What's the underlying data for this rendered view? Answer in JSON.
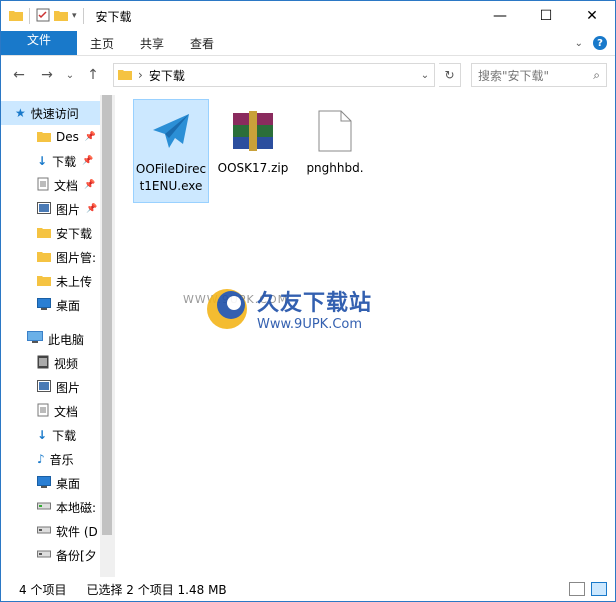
{
  "window": {
    "title": "安下载",
    "controls": [
      "minimize",
      "maximize",
      "close"
    ]
  },
  "ribbon": {
    "tabs": [
      {
        "label": "文件",
        "active": true
      },
      {
        "label": "主页"
      },
      {
        "label": "共享"
      },
      {
        "label": "查看"
      }
    ],
    "help": "?"
  },
  "address": {
    "path": "安下载",
    "search_placeholder": "搜索\"安下载\""
  },
  "sidebar": {
    "quick_access": "快速访问",
    "quick_items": [
      {
        "label": "Des",
        "icon": "folder-icon",
        "pinned": true
      },
      {
        "label": "下载",
        "icon": "download-arrow-icon",
        "pinned": true
      },
      {
        "label": "文档",
        "icon": "document-icon",
        "pinned": true
      },
      {
        "label": "图片",
        "icon": "picture-icon",
        "pinned": true
      },
      {
        "label": "安下载",
        "icon": "folder-icon"
      },
      {
        "label": "图片管:",
        "icon": "folder-icon"
      },
      {
        "label": "未上传",
        "icon": "folder-icon"
      },
      {
        "label": "桌面",
        "icon": "desktop-icon"
      }
    ],
    "this_pc": "此电脑",
    "pc_items": [
      {
        "label": "视频",
        "icon": "video-icon"
      },
      {
        "label": "图片",
        "icon": "picture-icon"
      },
      {
        "label": "文档",
        "icon": "document-icon"
      },
      {
        "label": "下载",
        "icon": "download-arrow-icon"
      },
      {
        "label": "音乐",
        "icon": "music-note-icon"
      },
      {
        "label": "桌面",
        "icon": "desktop-icon"
      },
      {
        "label": "本地磁:",
        "icon": "drive-icon"
      },
      {
        "label": "软件 (D",
        "icon": "drive-icon"
      },
      {
        "label": "备份[夕",
        "icon": "drive-icon"
      }
    ]
  },
  "files": [
    {
      "name": "OOFileDirect1ENU.exe",
      "icon": "paper-plane-icon",
      "selected": true
    },
    {
      "name": "OOSK17.zip",
      "icon": "winrar-archive-icon",
      "selected": false
    },
    {
      "name": "pnghhbd.",
      "icon": "blank-file-icon",
      "selected": false
    }
  ],
  "watermark": {
    "faint": "WWW.9UPK.COM",
    "title": "久友下载站",
    "url": "Www.9UPK.Com"
  },
  "status": {
    "count": "4 个项目",
    "selection": "已选择 2 个项目  1.48 MB"
  },
  "colors": {
    "accent": "#1979ca",
    "selection": "#cce8ff"
  }
}
